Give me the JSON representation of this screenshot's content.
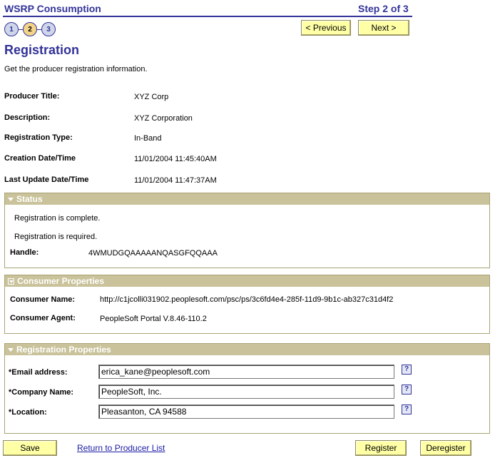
{
  "wizard": {
    "title": "WSRP Consumption",
    "step_label": "Step 2 of 3",
    "steps": [
      "1",
      "2",
      "3"
    ],
    "previous_label": "< Previous",
    "next_label": "Next >"
  },
  "page": {
    "title": "Registration",
    "instructions": "Get the producer registration information."
  },
  "producer": {
    "title_label": "Producer Title:",
    "title_value": "XYZ Corp",
    "description_label": "Description:",
    "description_value": "XYZ Corporation",
    "reg_type_label": "Registration Type:",
    "reg_type_value": "In-Band",
    "created_label": "Creation Date/Time",
    "created_value": "11/01/2004 11:45:40AM",
    "updated_label": "Last Update Date/Time",
    "updated_value": "11/01/2004 11:47:37AM"
  },
  "status": {
    "header": "Status",
    "complete_text": "Registration is complete.",
    "required_text": "Registration is required.",
    "handle_label": "Handle:",
    "handle_value": "4WMUDGQAAAAANQASGFQQAAA"
  },
  "consumer": {
    "header": "Consumer Properties",
    "name_label": "Consumer Name:",
    "name_value": "http://c1jcolli031902.peoplesoft.com/psc/ps/3c6fd4e4-285f-11d9-9b1c-ab327c31d4f2",
    "agent_label": "Consumer Agent:",
    "agent_value": "PeopleSoft Portal V.8.46-110.2"
  },
  "registration": {
    "header": "Registration Properties",
    "email_label": "*Email address:",
    "email_value": "erica_kane@peoplesoft.com",
    "company_label": "*Company Name:",
    "company_value": "PeopleSoft, Inc.",
    "location_label": "*Location:",
    "location_value": "Pleasanton, CA 94588",
    "help_glyph": "?"
  },
  "footer": {
    "save_label": "Save",
    "return_link": "Return to Producer List",
    "register_label": "Register",
    "deregister_label": "Deregister"
  },
  "colors": {
    "title_blue": "#333399",
    "group_header": "#c9c29a",
    "button_yellow": "#ffffa6",
    "link_blue": "#1a1aa6"
  }
}
